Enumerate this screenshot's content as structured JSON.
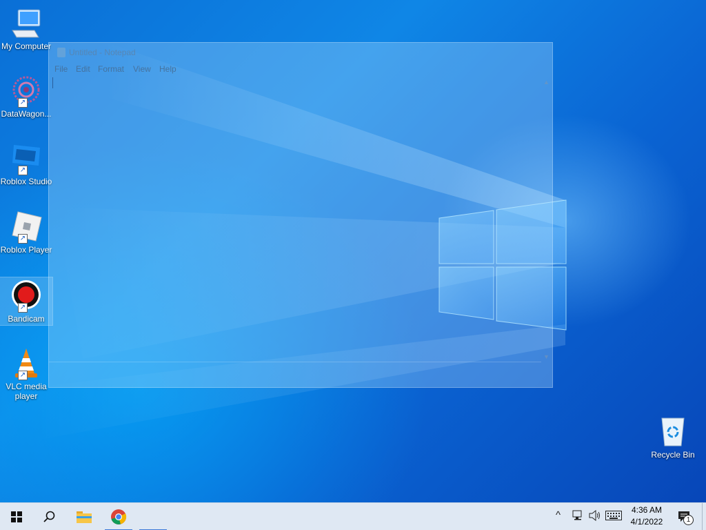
{
  "desktop": {
    "icons": [
      {
        "label": "My Computer",
        "icon": "computer-icon",
        "shortcut": false,
        "selected": false
      },
      {
        "label": "DataWagon...",
        "icon": "datawagon-icon",
        "shortcut": true,
        "selected": false
      },
      {
        "label": "Roblox Studio",
        "icon": "roblox-studio-icon",
        "shortcut": true,
        "selected": false
      },
      {
        "label": "Roblox Player",
        "icon": "roblox-player-icon",
        "shortcut": true,
        "selected": false
      },
      {
        "label": "Bandicam",
        "icon": "bandicam-icon",
        "shortcut": true,
        "selected": true
      },
      {
        "label": "VLC media player",
        "icon": "vlc-icon",
        "shortcut": true,
        "selected": false
      }
    ],
    "recycle_bin": {
      "label": "Recycle Bin",
      "icon": "recycle-bin-icon"
    }
  },
  "notepad": {
    "title": "Untitled - Notepad",
    "menu": [
      "File",
      "Edit",
      "Format",
      "View",
      "Help"
    ],
    "content": ""
  },
  "taskbar": {
    "start_icon": "windows-start-icon",
    "search_icon": "search-icon",
    "pinned": [
      {
        "name": "file-explorer-icon",
        "running": false
      },
      {
        "name": "chrome-icon",
        "running": true
      },
      {
        "name": "notepad-taskbar-icon",
        "running": true
      }
    ],
    "tray": {
      "chevron": "^",
      "notification_count": "1"
    },
    "clock": {
      "time": "4:36 AM",
      "date": "4/1/2022"
    }
  },
  "colors": {
    "wallpaper": "#0a6fd6",
    "taskbar": "#dfe8f3",
    "accent": "#3b78d8"
  }
}
